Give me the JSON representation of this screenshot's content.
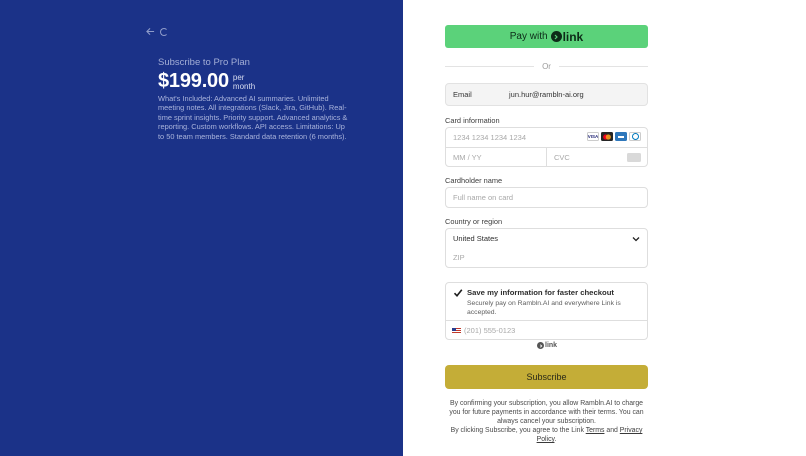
{
  "summary": {
    "back_icon": "arrow-left-icon",
    "plan_title": "Subscribe to Pro Plan",
    "price": "$199.00",
    "per": "per",
    "month": "month",
    "description": "What's Included: Advanced AI summaries. Unlimited meeting notes. All integrations (Slack, Jira, GitHub). Real-time sprint insights. Priority support. Advanced analytics & reporting. Custom workflows. API access. Limitations: Up to 50 team members. Standard data retention (6 months)."
  },
  "checkout": {
    "pay_with_label": "Pay with",
    "link_brand": "link",
    "or_label": "Or",
    "email_label": "Email",
    "email_value": "jun.hur@rambln-ai.org",
    "card_label": "Card information",
    "card_number_placeholder": "1234 1234 1234 1234",
    "expiry_placeholder": "MM / YY",
    "cvc_placeholder": "CVC",
    "card_brands": [
      "VISA",
      "mastercard",
      "AMEX",
      "diners"
    ],
    "cardholder_label": "Cardholder name",
    "cardholder_placeholder": "Full name on card",
    "country_label": "Country or region",
    "country_value": "United States",
    "zip_placeholder": "ZIP",
    "save_title": "Save my information for faster checkout",
    "save_sub": "Securely pay on Rambln.AI and everywhere Link is accepted.",
    "save_checked": true,
    "phone_placeholder": "(201) 555-0123",
    "link_small": "link",
    "subscribe_label": "Subscribe",
    "terms_line1": "By confirming your subscription, you allow Rambln.AI to charge you for future payments in accordance with their terms. You can always cancel your subscription.",
    "terms_line2_pre": "By clicking Subscribe, you agree to the Link",
    "terms_link": "Terms",
    "terms_and": "and",
    "privacy_link": "Privacy Policy",
    "terms_end": "."
  },
  "colors": {
    "left_panel": "#1b3288",
    "link_button": "#5bd27a",
    "subscribe_button": "#c4ad37"
  }
}
